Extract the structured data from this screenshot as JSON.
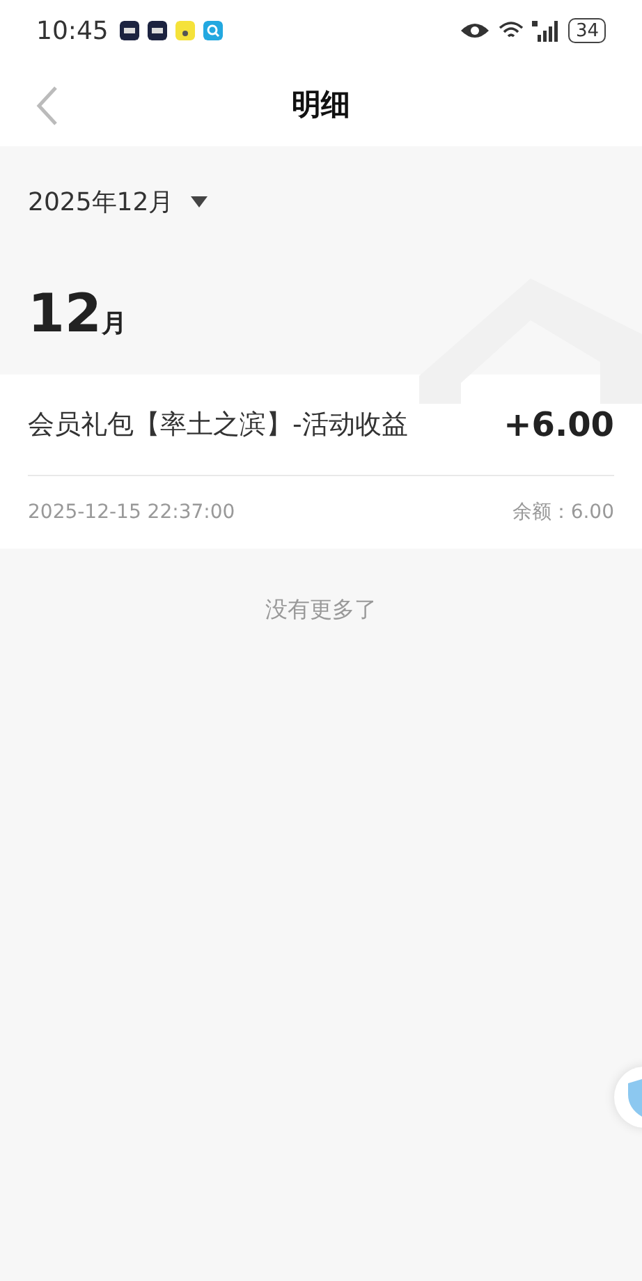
{
  "status_bar": {
    "time": "10:45",
    "battery": "34"
  },
  "header": {
    "title": "明细"
  },
  "month_picker": {
    "label": "2025年12月"
  },
  "month_heading": {
    "number": "12",
    "unit": "月"
  },
  "records": [
    {
      "title": "会员礼包【率土之滨】-活动收益",
      "amount": "+6.00",
      "time": "2025-12-15 22:37:00",
      "balance": "余额：6.00"
    }
  ],
  "end_note": "没有更多了"
}
